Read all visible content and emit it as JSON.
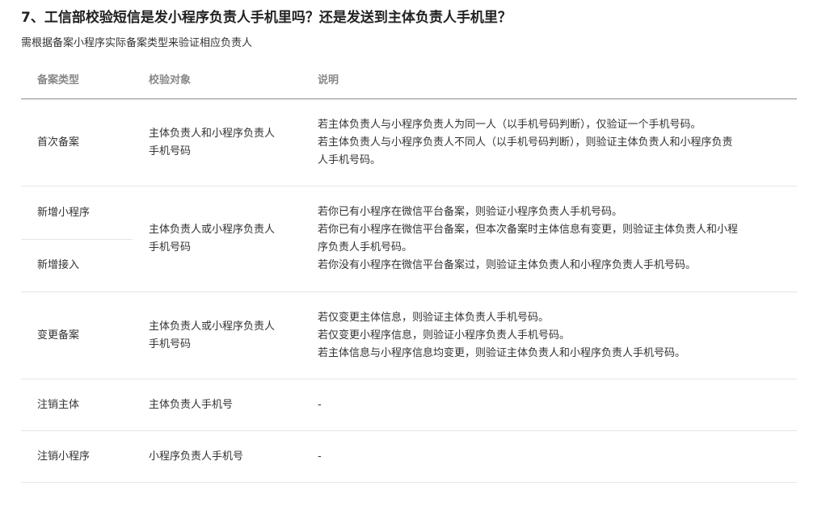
{
  "title": "7、工信部校验短信是发小程序负责人手机里吗？还是发送到主体负责人手机里？",
  "subtitle": "需根据备案小程序实际备案类型来验证相应负责人",
  "table": {
    "headers": [
      "备案类型",
      "校验对象",
      "说明"
    ],
    "rows": [
      {
        "type": "首次备案",
        "target": [
          "主体负责人和小程序负责人",
          "手机号码"
        ],
        "desc": [
          "若主体负责人与小程序负责人为同一人（以手机号码判断），仅验证一个手机号码。",
          "若主体负责人与小程序负责人不同人（以手机号码判断），则验证主体负责人和小程序负责",
          "人手机号码。"
        ]
      },
      {
        "type": [
          "新增小程序",
          "新增接入"
        ],
        "target": [
          "主体负责人或小程序负责人",
          "手机号码"
        ],
        "desc": [
          "若你已有小程序在微信平台备案，则验证小程序负责人手机号码。",
          "若你已有小程序在微信平台备案，但本次备案时主体信息有变更，则验证主体负责人和小程",
          "序负责人手机号码。",
          "若你没有小程序在微信平台备案过，则验证主体负责人和小程序负责人手机号码。"
        ]
      },
      {
        "type": "变更备案",
        "target": [
          "主体负责人或小程序负责人",
          "手机号码"
        ],
        "desc": [
          "若仅变更主体信息，则验证主体负责人手机号码。",
          "若仅变更小程序信息，则验证小程序负责人手机号码。",
          "若主体信息与小程序信息均变更，则验证主体负责人和小程序负责人手机号码。"
        ]
      },
      {
        "type": "注销主体",
        "target": [
          "主体负责人手机号"
        ],
        "desc": [
          "-"
        ]
      },
      {
        "type": "注销小程序",
        "target": [
          "小程序负责人手机号"
        ],
        "desc": [
          "-"
        ]
      }
    ]
  }
}
